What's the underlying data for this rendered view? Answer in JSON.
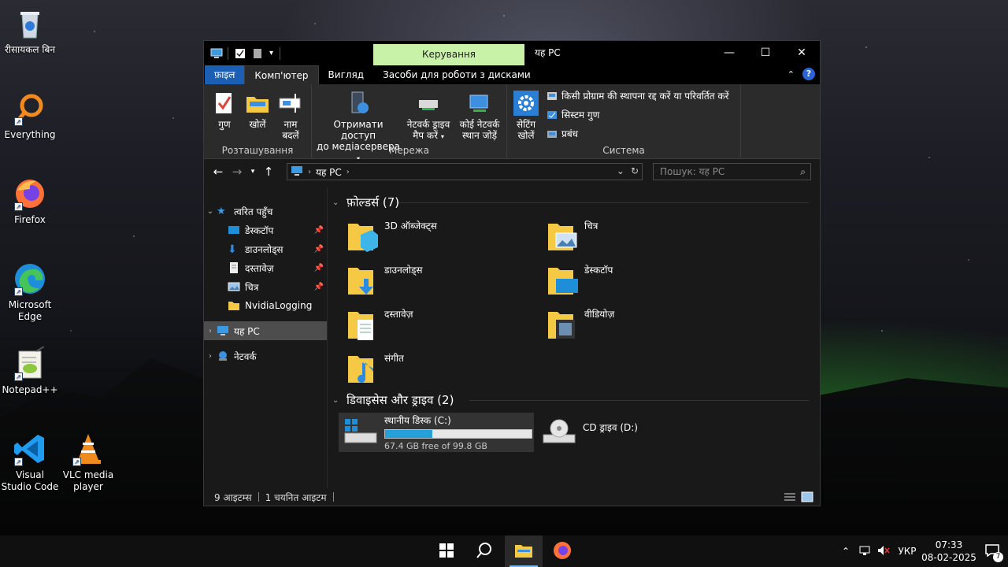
{
  "desktop": {
    "icons": [
      {
        "label": "रीसायकल बिन",
        "icon": "recycle-bin-icon"
      },
      {
        "label": "Everything",
        "icon": "everything-search-icon"
      },
      {
        "label": "Firefox",
        "icon": "firefox-icon"
      },
      {
        "label": "Microsoft Edge",
        "icon": "edge-icon"
      },
      {
        "label": "Notepad++",
        "icon": "notepad-plus-plus-icon"
      },
      {
        "label": "Visual Studio Code",
        "icon": "vscode-icon"
      },
      {
        "label": "VLC media player",
        "icon": "vlc-icon"
      }
    ]
  },
  "window": {
    "context_tab": "Керування",
    "title": "यह PC",
    "tabs": [
      "फ़ाइल",
      "Комп'ютер",
      "Вигляд",
      "Засоби для роботи з дисками"
    ],
    "ribbon": {
      "location": {
        "label": "Розташування",
        "buttons": [
          {
            "label1": "गुण",
            "label2": ""
          },
          {
            "label1": "खोलें",
            "label2": ""
          },
          {
            "label1": "नाम",
            "label2": "बदलें"
          }
        ]
      },
      "network": {
        "label": "Мережа",
        "buttons": [
          {
            "label1": "Отримати доступ",
            "label2": "до медіасервера"
          },
          {
            "label1": "नेटवर्क ड्राइव",
            "label2": "मैप करें"
          },
          {
            "label1": "कोई नेटवर्क",
            "label2": "स्थान जोड़ें"
          }
        ]
      },
      "system": {
        "label": "Система",
        "open_settings1": "सेटिंग",
        "open_settings2": "खोलें",
        "uninstall": "किसी प्रोग्राम की स्थापना रद्द करें या परिवर्तित करें",
        "system_properties": "सिस्टम गुण",
        "manage": "प्रबंध"
      }
    },
    "address": {
      "crumb": "यह PC",
      "search_placeholder": "Пошук: यह PC"
    },
    "nav_pane": {
      "quick_access": "त्वरित पहुँच",
      "pinned": [
        "डेस्कटॉप",
        "डाउनलोड्स",
        "दस्तावेज़",
        "चित्र"
      ],
      "other": "NvidiaLogging",
      "this_pc": "यह PC",
      "network": "नेटवर्क"
    },
    "folders_header": "फ़ोल्डर्स (7)",
    "folders": [
      "3D ऑब्जेक्ट्स",
      "चित्र",
      "डाउनलोड्स",
      "डेस्कटॉप",
      "दस्तावेज़",
      "वीडियोज़",
      "संगीत"
    ],
    "devices_header": "डिवाइसेस और ड्राइव (2)",
    "drives": [
      {
        "name": "स्थानीय डिस्क (C:)",
        "free": "67.4 GB free of 99.8 GB",
        "used_fraction": 0.325
      },
      {
        "name": "CD ड्राइव (D:)"
      }
    ],
    "status": {
      "items": "9 आइटम्स",
      "selected": "1 चयनित आइटम"
    }
  },
  "taskbar": {
    "language": "УКР",
    "time": "07:33",
    "date": "08-02-2025",
    "notifications": "7"
  },
  "colors": {
    "context_tab": "#c8f2a8",
    "file_tab": "#1a5fb4",
    "progress": "#26a0da"
  }
}
